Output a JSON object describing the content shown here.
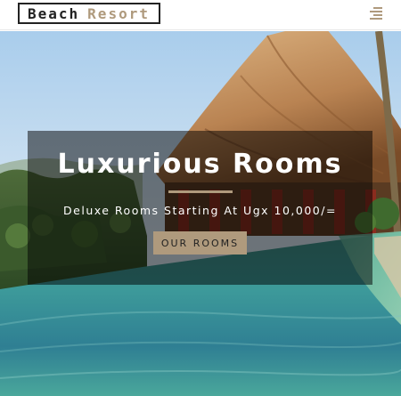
{
  "navbar": {
    "logo": {
      "word1": "Beach",
      "word2": "Resort"
    },
    "menu_icon": "hamburger-icon"
  },
  "hero": {
    "background": "tropical-infinity-pool-photo",
    "title": "Luxurious Rooms",
    "subtitle": "Deluxe Rooms Starting At Ugx 10,000/=",
    "button_label": "OUR ROOMS"
  },
  "colors": {
    "accent": "#af9a7d",
    "text_dark": "#222222",
    "banner_overlay": "rgba(0,0,0,0.5)"
  }
}
